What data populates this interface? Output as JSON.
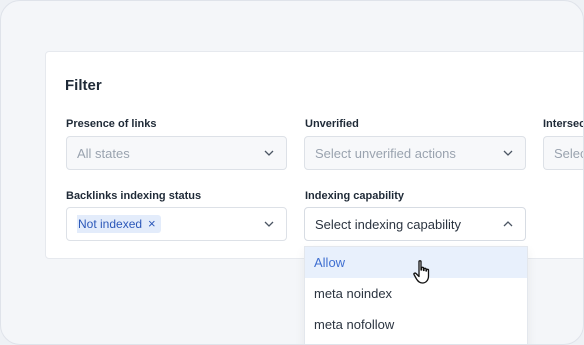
{
  "filter": {
    "title": "Filter"
  },
  "presence": {
    "label": "Presence of links",
    "value": "All states"
  },
  "unverified": {
    "label": "Unverified",
    "placeholder": "Select unverified actions"
  },
  "intersect": {
    "label": "Intersect",
    "placeholder": "Selec"
  },
  "backlinks": {
    "label": "Backlinks indexing status",
    "chip": "Not indexed",
    "chip_close": "×"
  },
  "indexing": {
    "label": "Indexing capability",
    "placeholder": "Select indexing capability",
    "options": [
      "Allow",
      "meta noindex",
      "meta nofollow"
    ],
    "highlighted": 0
  },
  "colors": {
    "accent": "#3f6fd1",
    "chip_bg": "#e3ecfb",
    "highlight_bg": "#e8f0fc"
  },
  "icons": {
    "chevron_down": "chevron-down-icon",
    "chevron_up": "chevron-up-icon",
    "cursor": "hand-pointer-icon"
  }
}
